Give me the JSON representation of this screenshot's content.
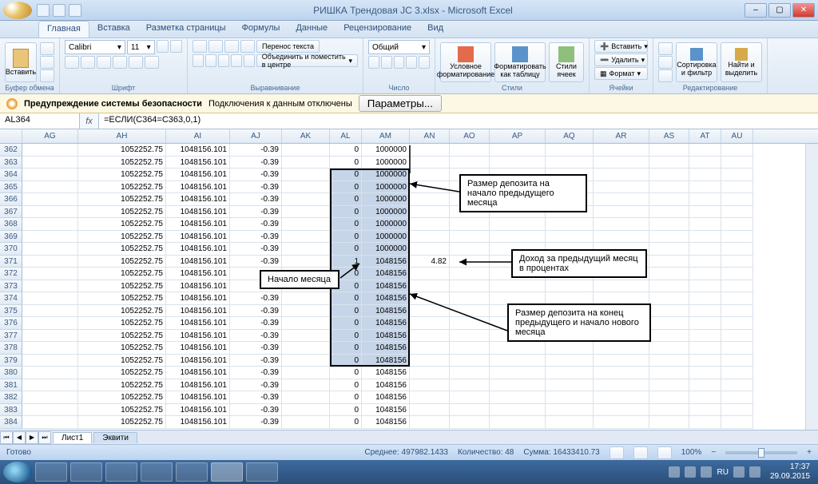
{
  "titlebar": {
    "title": "РИШКА Трендовая JC 3.xlsx - Microsoft Excel"
  },
  "ribbon_tabs": [
    "Главная",
    "Вставка",
    "Разметка страницы",
    "Формулы",
    "Данные",
    "Рецензирование",
    "Вид"
  ],
  "ribbon": {
    "clipboard": {
      "paste": "Вставить",
      "label": "Буфер обмена"
    },
    "font": {
      "family": "Calibri",
      "size": "11",
      "label": "Шрифт"
    },
    "alignment": {
      "wrap": "Перенос текста",
      "merge": "Объединить и поместить в центре",
      "label": "Выравнивание"
    },
    "number": {
      "format": "Общий",
      "label": "Число"
    },
    "styles": {
      "cond": "Условное форматирование",
      "table": "Форматировать как таблицу",
      "cell": "Стили ячеек",
      "label": "Стили"
    },
    "cells": {
      "insert": "Вставить",
      "delete": "Удалить",
      "format": "Формат",
      "label": "Ячейки"
    },
    "editing": {
      "sort": "Сортировка и фильтр",
      "find": "Найти и выделить",
      "label": "Редактирование"
    }
  },
  "security": {
    "title": "Предупреждение системы безопасности",
    "msg": "Подключения к данным отключены",
    "btn": "Параметры..."
  },
  "formula_bar": {
    "name": "AL364",
    "formula": "=ЕСЛИ(C364=C363,0,1)"
  },
  "columns": [
    {
      "id": "AG",
      "w": 70
    },
    {
      "id": "AH",
      "w": 110
    },
    {
      "id": "AI",
      "w": 80
    },
    {
      "id": "AJ",
      "w": 65
    },
    {
      "id": "AK",
      "w": 60
    },
    {
      "id": "AL",
      "w": 40
    },
    {
      "id": "AM",
      "w": 60
    },
    {
      "id": "AN",
      "w": 50
    },
    {
      "id": "AO",
      "w": 50
    },
    {
      "id": "AP",
      "w": 70
    },
    {
      "id": "AQ",
      "w": 60
    },
    {
      "id": "AR",
      "w": 70
    },
    {
      "id": "AS",
      "w": 50
    },
    {
      "id": "AT",
      "w": 40
    },
    {
      "id": "AU",
      "w": 40
    }
  ],
  "rows": [
    {
      "n": 362,
      "AH": "1052252.75",
      "AI": "1048156.101",
      "AJ": "-0.39",
      "AL": "0",
      "AM": "1000000"
    },
    {
      "n": 363,
      "AH": "1052252.75",
      "AI": "1048156.101",
      "AJ": "-0.39",
      "AL": "0",
      "AM": "1000000"
    },
    {
      "n": 364,
      "AH": "1052252.75",
      "AI": "1048156.101",
      "AJ": "-0.39",
      "AL": "0",
      "AM": "1000000"
    },
    {
      "n": 365,
      "AH": "1052252.75",
      "AI": "1048156.101",
      "AJ": "-0.39",
      "AL": "0",
      "AM": "1000000"
    },
    {
      "n": 366,
      "AH": "1052252.75",
      "AI": "1048156.101",
      "AJ": "-0.39",
      "AL": "0",
      "AM": "1000000"
    },
    {
      "n": 367,
      "AH": "1052252.75",
      "AI": "1048156.101",
      "AJ": "-0.39",
      "AL": "0",
      "AM": "1000000"
    },
    {
      "n": 368,
      "AH": "1052252.75",
      "AI": "1048156.101",
      "AJ": "-0.39",
      "AL": "0",
      "AM": "1000000"
    },
    {
      "n": 369,
      "AH": "1052252.75",
      "AI": "1048156.101",
      "AJ": "-0.39",
      "AL": "0",
      "AM": "1000000"
    },
    {
      "n": 370,
      "AH": "1052252.75",
      "AI": "1048156.101",
      "AJ": "-0.39",
      "AL": "0",
      "AM": "1000000"
    },
    {
      "n": 371,
      "AH": "1052252.75",
      "AI": "1048156.101",
      "AJ": "-0.39",
      "AL": "1",
      "AM": "1048156",
      "AN": "4.82"
    },
    {
      "n": 372,
      "AH": "1052252.75",
      "AI": "1048156.101",
      "AJ": "-0.39",
      "AL": "0",
      "AM": "1048156"
    },
    {
      "n": 373,
      "AH": "1052252.75",
      "AI": "1048156.101",
      "AJ": "-0.39",
      "AL": "0",
      "AM": "1048156"
    },
    {
      "n": 374,
      "AH": "1052252.75",
      "AI": "1048156.101",
      "AJ": "-0.39",
      "AL": "0",
      "AM": "1048156"
    },
    {
      "n": 375,
      "AH": "1052252.75",
      "AI": "1048156.101",
      "AJ": "-0.39",
      "AL": "0",
      "AM": "1048156"
    },
    {
      "n": 376,
      "AH": "1052252.75",
      "AI": "1048156.101",
      "AJ": "-0.39",
      "AL": "0",
      "AM": "1048156"
    },
    {
      "n": 377,
      "AH": "1052252.75",
      "AI": "1048156.101",
      "AJ": "-0.39",
      "AL": "0",
      "AM": "1048156"
    },
    {
      "n": 378,
      "AH": "1052252.75",
      "AI": "1048156.101",
      "AJ": "-0.39",
      "AL": "0",
      "AM": "1048156"
    },
    {
      "n": 379,
      "AH": "1052252.75",
      "AI": "1048156.101",
      "AJ": "-0.39",
      "AL": "0",
      "AM": "1048156"
    },
    {
      "n": 380,
      "AH": "1052252.75",
      "AI": "1048156.101",
      "AJ": "-0.39",
      "AL": "0",
      "AM": "1048156"
    },
    {
      "n": 381,
      "AH": "1052252.75",
      "AI": "1048156.101",
      "AJ": "-0.39",
      "AL": "0",
      "AM": "1048156"
    },
    {
      "n": 382,
      "AH": "1052252.75",
      "AI": "1048156.101",
      "AJ": "-0.39",
      "AL": "0",
      "AM": "1048156"
    },
    {
      "n": 383,
      "AH": "1052252.75",
      "AI": "1048156.101",
      "AJ": "-0.39",
      "AL": "0",
      "AM": "1048156"
    },
    {
      "n": 384,
      "AH": "1052252.75",
      "AI": "1048156.101",
      "AJ": "-0.39",
      "AL": "0",
      "AM": "1048156"
    }
  ],
  "selection": {
    "cols": [
      "AL",
      "AM"
    ],
    "rowStart": 364,
    "rowEnd": 379
  },
  "annotations": {
    "a1": "Размер депозита на начало предыдущего месяца",
    "a2": "Доход за предыдущий месяц в процентах",
    "a3": "Размер депозита на конец предыдущего и начало нового месяца",
    "a4": "Начало месяца"
  },
  "sheets": {
    "active": "Лист1",
    "other": "Эквити"
  },
  "status": {
    "ready": "Готово",
    "avg_label": "Среднее:",
    "avg": "497982.1433",
    "count_label": "Количество:",
    "count": "48",
    "sum_label": "Сумма:",
    "sum": "16433410.73",
    "zoom": "100%"
  },
  "tray": {
    "lang": "RU",
    "time": "17:37",
    "date": "29.09.2015"
  }
}
